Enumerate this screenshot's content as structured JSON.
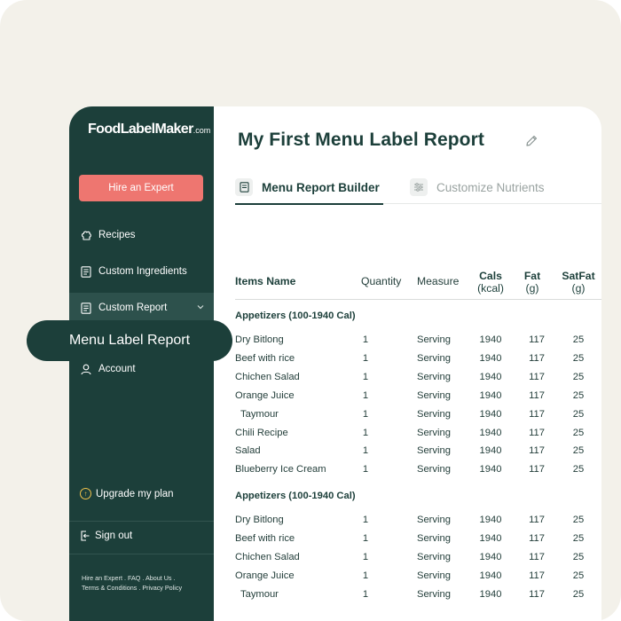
{
  "sidebar": {
    "logo_main": "FoodLabelMaker",
    "logo_suffix": ".com",
    "hire_label": "Hire an Expert",
    "items": [
      {
        "label": "Recipes",
        "icon": "chef-hat-icon"
      },
      {
        "label": "Custom Ingredients",
        "icon": "document-icon"
      },
      {
        "label": "Custom Report",
        "icon": "document-icon"
      },
      {
        "label": "Account",
        "icon": "user-icon"
      }
    ],
    "upgrade_label": "Upgrade my plan",
    "signout_label": "Sign out",
    "footer": {
      "hire": "Hire an Expert",
      "faq": "FAQ",
      "about": "About Us",
      "terms": "Terms & Conditions",
      "privacy": "Privacy Policy"
    }
  },
  "floating_pill": "Menu Label Report",
  "main": {
    "title": "My First Menu Label Report",
    "tabs": [
      {
        "label": "Menu Report Builder"
      },
      {
        "label": "Customize Nutrients"
      }
    ]
  },
  "table": {
    "headers": {
      "name": "Items Name",
      "quantity": "Quantity",
      "measure": "Measure",
      "cals": "Cals",
      "cals_unit": "(kcal)",
      "fat": "Fat",
      "fat_unit": "(g)",
      "satfat": "SatFat",
      "satfat_unit": "(g)"
    },
    "groups": [
      {
        "title": "Appetizers (100-1940 Cal)",
        "rows": [
          {
            "name": "Dry Bitlong",
            "qty": "1",
            "measure": "Serving",
            "cals": "1940",
            "fat": "117",
            "satfat": "25"
          },
          {
            "name": "Beef with rice",
            "qty": "1",
            "measure": "Serving",
            "cals": "1940",
            "fat": "117",
            "satfat": "25"
          },
          {
            "name": "Chichen Salad",
            "qty": "1",
            "measure": "Serving",
            "cals": "1940",
            "fat": "117",
            "satfat": "25"
          },
          {
            "name": "Orange Juice",
            "qty": "1",
            "measure": "Serving",
            "cals": "1940",
            "fat": "117",
            "satfat": "25"
          },
          {
            "name": "Taymour",
            "qty": "1",
            "measure": "Serving",
            "cals": "1940",
            "fat": "117",
            "satfat": "25"
          },
          {
            "name": "Chili Recipe",
            "qty": "1",
            "measure": "Serving",
            "cals": "1940",
            "fat": "117",
            "satfat": "25"
          },
          {
            "name": "Salad",
            "qty": "1",
            "measure": "Serving",
            "cals": "1940",
            "fat": "117",
            "satfat": "25"
          },
          {
            "name": "Blueberry Ice Cream",
            "qty": "1",
            "measure": "Serving",
            "cals": "1940",
            "fat": "117",
            "satfat": "25"
          }
        ]
      },
      {
        "title": "Appetizers (100-1940 Cal)",
        "rows": [
          {
            "name": "Dry Bitlong",
            "qty": "1",
            "measure": "Serving",
            "cals": "1940",
            "fat": "117",
            "satfat": "25"
          },
          {
            "name": "Beef with rice",
            "qty": "1",
            "measure": "Serving",
            "cals": "1940",
            "fat": "117",
            "satfat": "25"
          },
          {
            "name": "Chichen Salad",
            "qty": "1",
            "measure": "Serving",
            "cals": "1940",
            "fat": "117",
            "satfat": "25"
          },
          {
            "name": "Orange Juice",
            "qty": "1",
            "measure": "Serving",
            "cals": "1940",
            "fat": "117",
            "satfat": "25"
          },
          {
            "name": "Taymour",
            "qty": "1",
            "measure": "Serving",
            "cals": "1940",
            "fat": "117",
            "satfat": "25"
          }
        ]
      }
    ]
  },
  "colors": {
    "sidebar": "#1c3f3a",
    "accent": "#ee7670",
    "background": "#f3f1ea",
    "text": "#243f3b"
  }
}
